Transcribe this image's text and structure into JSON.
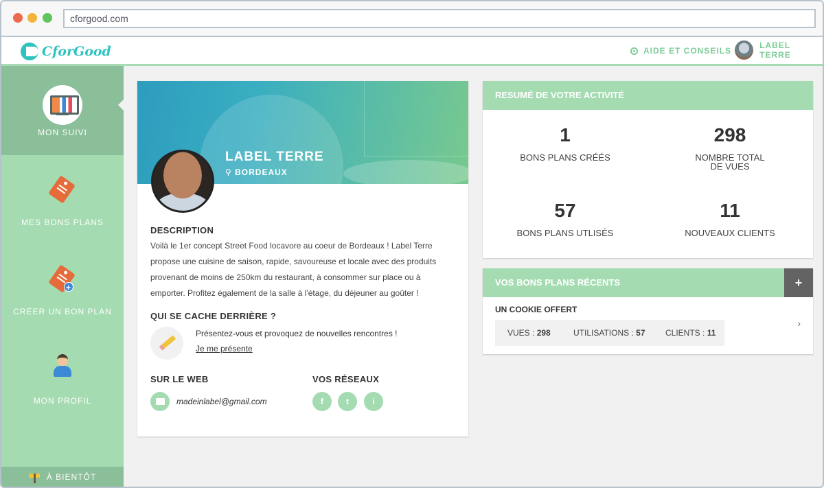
{
  "browser": {
    "url": "cforgood.com"
  },
  "header": {
    "logo_text": "CforGood",
    "help_label": "AIDE ET CONSEILS",
    "user_label": "LABEL TERRE"
  },
  "sidebar": {
    "items": [
      {
        "label": "MON SUIVI",
        "icon": "monitor-chart-icon",
        "active": true
      },
      {
        "label": "MES BONS PLANS",
        "icon": "tag-icon",
        "active": false
      },
      {
        "label": "CRÉER UN BON PLAN",
        "icon": "tag-plus-icon",
        "active": false
      },
      {
        "label": "MON PROFIL",
        "icon": "user-icon",
        "active": false
      }
    ],
    "footer_label": "À BIENTÔT"
  },
  "profile": {
    "name": "LABEL TERRE",
    "city": "BORDEAUX",
    "description_title": "DESCRIPTION",
    "description": "Voilà le 1er concept Street Food locavore au coeur de Bordeaux ! Label Terre propose une cuisine de saison, rapide, savoureuse et locale avec des produits provenant de moins de 250km du restaurant, à consommer sur place ou à emporter. Profitez également de la salle à l'étage, du déjeuner au goûter !",
    "who_title": "QUI SE CACHE DERRIÈRE ?",
    "intro_text": "Présentez-vous et provoquez de nouvelles rencontres !",
    "intro_link": "Je me présente",
    "web_title": "SUR LE WEB",
    "email": "madeinlabel@gmail.com",
    "networks_title": "VOS RÉSEAUX",
    "networks": [
      "f",
      "t",
      "i"
    ]
  },
  "summary": {
    "title": "RESUMÉ DE VOTRE ACTIVITÉ",
    "stats": [
      {
        "value": "1",
        "label": "BONS PLANS CRÉÉS",
        "label2": ""
      },
      {
        "value": "298",
        "label": "NOMBRE TOTAL",
        "label2": "DE VUES"
      },
      {
        "value": "57",
        "label": "BONS PLANS UTLISÉS",
        "label2": ""
      },
      {
        "value": "11",
        "label": "NOUVEAUX CLIENTS",
        "label2": ""
      }
    ]
  },
  "recent": {
    "title": "VOS BONS PLANS RÉCENTS",
    "add_label": "+",
    "deal_title": "UN COOKIE OFFERT",
    "views_label": "VUES :",
    "views_value": "298",
    "uses_label": "UTILISATIONS :",
    "uses_value": "57",
    "clients_label": "CLIENTS :",
    "clients_value": "11",
    "chevron": "›"
  },
  "colors": {
    "accent_green": "#a4dbb1",
    "sidebar_active": "#8bbf99",
    "brand_teal": "#2fc3c0",
    "add_button": "#636363"
  }
}
